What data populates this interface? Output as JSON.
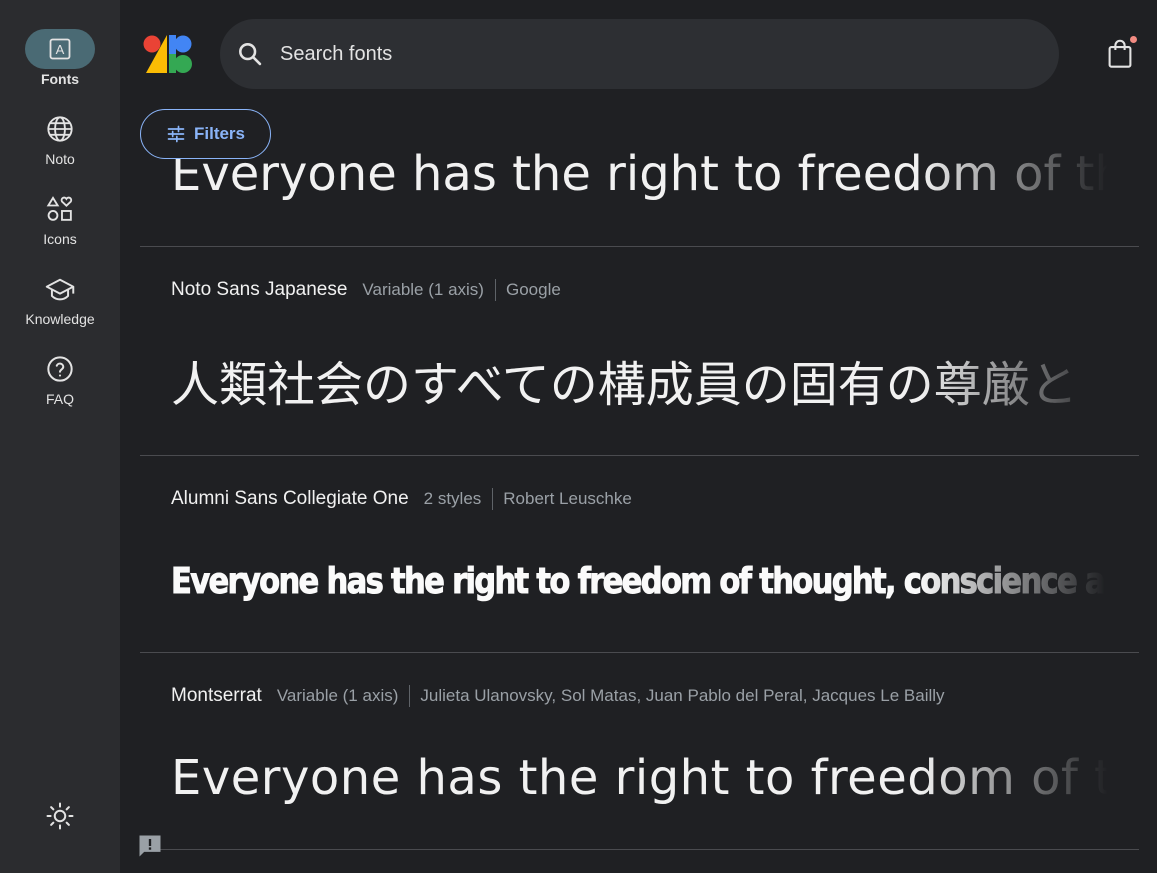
{
  "nav": {
    "items": [
      {
        "label": "Fonts",
        "icon": "fonts-icon",
        "active": true
      },
      {
        "label": "Noto",
        "icon": "globe-icon"
      },
      {
        "label": "Icons",
        "icon": "shapes-icon"
      },
      {
        "label": "Knowledge",
        "icon": "graduation-cap-icon"
      },
      {
        "label": "FAQ",
        "icon": "help-circle-icon"
      }
    ],
    "fonts_glyph": "A"
  },
  "search": {
    "placeholder": "Search fonts"
  },
  "filters": {
    "label": "Filters"
  },
  "fonts": [
    {
      "sample": "Everyone has the right to freedom of thought, conscience and religion"
    },
    {
      "name": "Noto Sans Japanese",
      "styles": "Variable (1 axis)",
      "author": "Google",
      "sample": "人類社会のすべての構成員の固有の尊厳と"
    },
    {
      "name": "Alumni Sans Collegiate One",
      "styles": "2 styles",
      "author": "Robert Leuschke",
      "sample": "Everyone has the right to freedom of thought, conscience and religion"
    },
    {
      "name": "Montserrat",
      "styles": "Variable (1 axis)",
      "author": "Julieta Ulanovsky, Sol Matas, Juan Pablo del Peral, Jacques Le Bailly",
      "sample": "Everyone has the right to freedom of thought"
    }
  ],
  "colors": {
    "accent": "#8ab4f8",
    "background": "#1f2023",
    "rail": "#2b2c2f",
    "active_pill": "#4a6a74",
    "badge": "#f28b82"
  }
}
